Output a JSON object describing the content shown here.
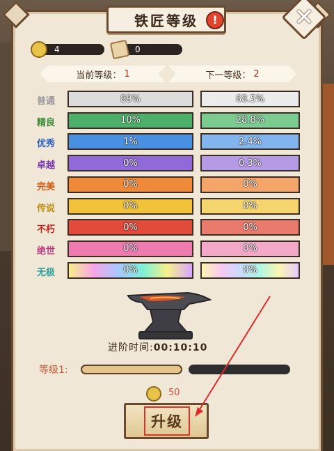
{
  "title": "铁匠等级",
  "currency": [
    {
      "icon": "coin-icon",
      "value": "4"
    },
    {
      "icon": "scroll-icon",
      "value": "0"
    }
  ],
  "level_header": {
    "current_label": "当前等级：",
    "current_value": "1",
    "next_label": "下一等级：",
    "next_value": "2"
  },
  "qualities": [
    {
      "name": "普通",
      "current": "89%",
      "next": "68.5%"
    },
    {
      "name": "精良",
      "current": "10%",
      "next": "28.8%"
    },
    {
      "name": "优秀",
      "current": "1%",
      "next": "2.4%"
    },
    {
      "name": "卓越",
      "current": "0%",
      "next": "0.3%"
    },
    {
      "name": "完美",
      "current": "0%",
      "next": "0%"
    },
    {
      "name": "传说",
      "current": "0%",
      "next": "0%"
    },
    {
      "name": "不朽",
      "current": "0%",
      "next": "0%"
    },
    {
      "name": "绝世",
      "current": "0%",
      "next": "0%"
    },
    {
      "name": "无极",
      "current": "0%",
      "next": "0%"
    }
  ],
  "quality_colors": {
    "label": [
      "#9a9a9a",
      "#3a8a3a",
      "#2a5fc0",
      "#7a3ab0",
      "#d05a14",
      "#c09010",
      "#c0281c",
      "#c03a80",
      "#2aa0a0"
    ],
    "current": [
      "#dcdcdc",
      "#4caf6a",
      "#4a90e2",
      "#8f6ad8",
      "#f08a3a",
      "#f2c23a",
      "#e24a3a",
      "#ee7ab0",
      "rainbow"
    ],
    "next": [
      "#ececec",
      "#7ccc92",
      "#82b4ee",
      "#b59ae6",
      "#f3a56a",
      "#f6d46e",
      "#ea7a6c",
      "#f4a8c8",
      "rainbow"
    ]
  },
  "advance_time_label": "进阶时间:",
  "advance_time_value": "00:10:10",
  "level_progress_label": "等级1:",
  "level_progress_fraction": 0.5,
  "cost": {
    "icon": "coin-icon",
    "value": "50"
  },
  "upgrade_label": "升级"
}
